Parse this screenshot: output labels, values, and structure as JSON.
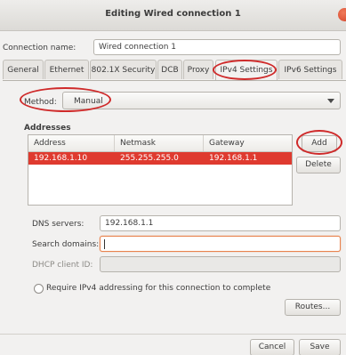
{
  "window": {
    "title": "Editing Wired connection 1"
  },
  "connection": {
    "label": "Connection name:",
    "value": "Wired connection 1"
  },
  "tabs": [
    {
      "label": "General"
    },
    {
      "label": "Ethernet"
    },
    {
      "label": "802.1X Security"
    },
    {
      "label": "DCB"
    },
    {
      "label": "Proxy"
    },
    {
      "label": "IPv4 Settings",
      "active": true
    },
    {
      "label": "IPv6 Settings"
    }
  ],
  "method": {
    "label": "Method:",
    "value": "Manual"
  },
  "addresses": {
    "heading": "Addresses",
    "columns": [
      "Address",
      "Netmask",
      "Gateway"
    ],
    "rows": [
      {
        "address": "192.168.1.10",
        "netmask": "255.255.255.0",
        "gateway": "192.168.1.1"
      }
    ],
    "add_label": "Add",
    "delete_label": "Delete"
  },
  "fields": {
    "dns_label": "DNS servers:",
    "dns_value": "192.168.1.1",
    "search_label": "Search domains:",
    "search_value": "",
    "dhcp_label": "DHCP client ID:",
    "dhcp_value": ""
  },
  "require_ipv4_label": "Require IPv4 addressing for this connection to complete",
  "buttons": {
    "routes": "Routes...",
    "cancel": "Cancel",
    "save": "Save"
  },
  "colors": {
    "annotation_ring": "#cf2a2a",
    "selection": "#df3a2f",
    "focus": "#e8834e"
  }
}
